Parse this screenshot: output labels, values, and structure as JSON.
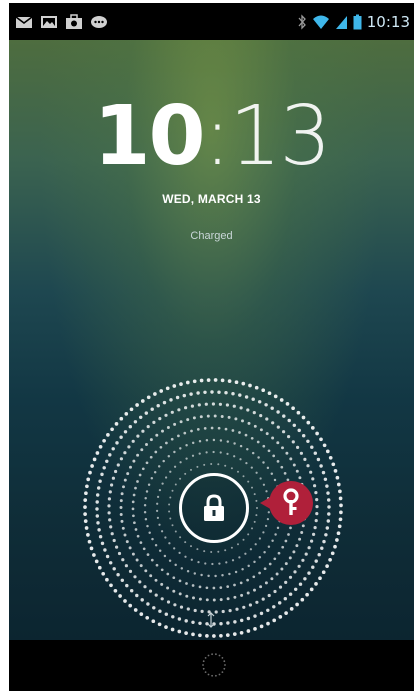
{
  "status_bar": {
    "left_icons": [
      "email-icon",
      "gallery-icon",
      "camera-shop-icon",
      "chat-icon"
    ],
    "right_icons": [
      "bluetooth-icon",
      "wifi-icon",
      "cell-signal-icon",
      "battery-icon"
    ],
    "time": "10:13"
  },
  "lockscreen": {
    "clock_hours": "10",
    "clock_separator": ":",
    "clock_minutes": "13",
    "date": "WED, MARCH 13",
    "charge_status": "Charged",
    "lock_icon": "padlock-icon",
    "unlock_target_icon": "key-icon",
    "hint_icon": "drag-hint-icon",
    "accent_color": "#b0203a"
  },
  "nav_bar": {
    "home_icon": "home-ring-icon"
  }
}
